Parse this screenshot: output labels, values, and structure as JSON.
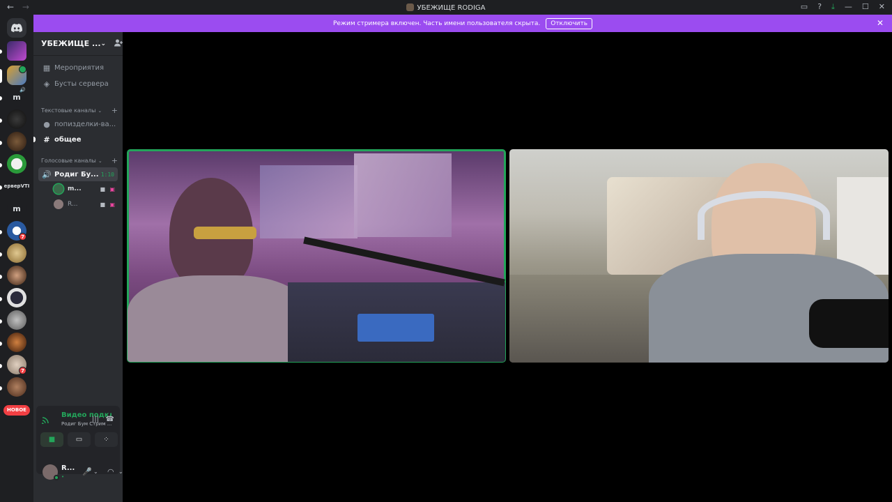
{
  "window": {
    "title": "УБЕЖИЩЕ RODIGA",
    "back": "←",
    "forward": "→",
    "controls": [
      "▭",
      "?",
      "⤓",
      "—",
      "☐",
      "✕"
    ]
  },
  "banner": {
    "text": "Режим стримера включен. Часть имени пользователя скрыта.",
    "button": "Отключить",
    "close": "✕"
  },
  "servers": {
    "labels": {
      "m1": "m",
      "ipe": "ерверVTI",
      "m2": "m"
    },
    "badges": [
      "7",
      "7"
    ],
    "new_pill": "НОВОЕ"
  },
  "guild": {
    "name": "УБЕЖИЩЕ ...",
    "chevron": "⌄",
    "invite_icon": "person-add-icon"
  },
  "channels": {
    "events": "Мероприятия",
    "boosts": "Бусты сервера",
    "text_category": "Текстовые каналы",
    "text_channels": [
      "попизделки-ва...",
      "общее"
    ],
    "voice_category": "Голосовые каналы",
    "voice_channel": "Родиг Бу...",
    "voice_time": "1:10",
    "voice_users": [
      "m...",
      "R..."
    ]
  },
  "voice_panel": {
    "status": "Видео подклю",
    "subtitle": "Родиг Бум Стрим ..."
  },
  "user": {
    "name": "R...",
    "sub": "•"
  },
  "colors": {
    "accent_green": "#23a55a",
    "banner_purple": "#9b4cf0",
    "badge_red": "#f23f43",
    "sidebar_bg": "#2b2d31",
    "server_rail_bg": "#1e1f22"
  }
}
